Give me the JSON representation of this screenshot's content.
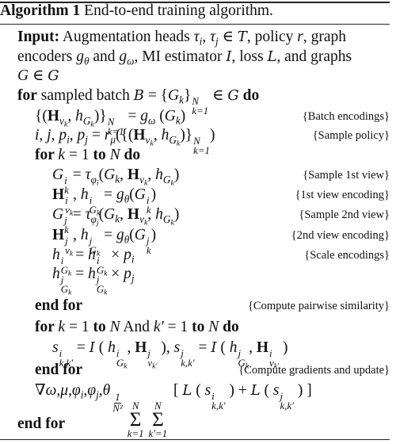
{
  "title": {
    "label": "Algorithm 1",
    "caption": " End-to-end training algorithm."
  },
  "lines": [
    {
      "indent": 1,
      "segs": [
        [
          "kw",
          "Input:"
        ],
        [
          "r",
          " Augmentation heads "
        ],
        [
          "m",
          "τ"
        ],
        [
          "sub",
          "i"
        ],
        [
          "r",
          ", "
        ],
        [
          "m",
          "τ"
        ],
        [
          "sub",
          "j"
        ],
        [
          "r",
          " ∈ "
        ],
        [
          "cal",
          "T"
        ],
        [
          "r",
          ", policy "
        ],
        [
          "m",
          "r"
        ],
        [
          "r",
          ", graph"
        ]
      ]
    },
    {
      "indent": 1,
      "segs": [
        [
          "r",
          "encoders "
        ],
        [
          "m",
          "g"
        ],
        [
          "sub",
          "θ"
        ],
        [
          "r",
          " and "
        ],
        [
          "m",
          "g"
        ],
        [
          "sub",
          "ω"
        ],
        [
          "r",
          ", MI estimator "
        ],
        [
          "cal",
          "I"
        ],
        [
          "r",
          ", loss "
        ],
        [
          "cal",
          "L"
        ],
        [
          "r",
          ", and graphs"
        ]
      ]
    },
    {
      "indent": 1,
      "segs": [
        [
          "m",
          "G"
        ],
        [
          "r",
          " ∈ "
        ],
        [
          "cal",
          "G"
        ]
      ]
    },
    {
      "indent": 1,
      "segs": [
        [
          "kw",
          "for"
        ],
        [
          "r",
          " sampled batch "
        ],
        [
          "cal",
          "B"
        ],
        [
          "r",
          " = {"
        ],
        [
          "m",
          "G"
        ],
        [
          "sub",
          "k"
        ],
        [
          "r",
          "}"
        ],
        [
          "ss",
          "N",
          "k=1"
        ],
        [
          "r",
          " ∈ "
        ],
        [
          "cal",
          "G"
        ],
        [
          "kw",
          " do"
        ]
      ]
    },
    {
      "indent": 2,
      "segs": [
        [
          "r",
          "{("
        ],
        [
          "B",
          "H"
        ],
        [
          "sub",
          "v_k"
        ],
        [
          "r",
          ", "
        ],
        [
          "m",
          "h"
        ],
        [
          "sub",
          "G_k"
        ],
        [
          "r",
          ")}"
        ],
        [
          "ss",
          "N",
          "k=1"
        ],
        [
          "r",
          " = "
        ],
        [
          "m",
          "g"
        ],
        [
          "sub",
          "ω"
        ],
        [
          "r",
          " ("
        ],
        [
          "m",
          "G"
        ],
        [
          "sub",
          "k"
        ],
        [
          "r",
          ")"
        ]
      ],
      "comment": "{Batch encodings}"
    },
    {
      "indent": 2,
      "segs": [
        [
          "m",
          "i, j, p"
        ],
        [
          "sub",
          "i"
        ],
        [
          "r",
          ", "
        ],
        [
          "m",
          "p"
        ],
        [
          "sub",
          "j"
        ],
        [
          "r",
          " = "
        ],
        [
          "m",
          "r"
        ],
        [
          "sub",
          "μ"
        ],
        [
          "r",
          "({("
        ],
        [
          "B",
          "H"
        ],
        [
          "sub",
          "v_k"
        ],
        [
          "r",
          ", "
        ],
        [
          "m",
          "h"
        ],
        [
          "sub",
          "G_k"
        ],
        [
          "r",
          ")}"
        ],
        [
          "ss",
          "N",
          "k=1"
        ],
        [
          "r",
          ")"
        ]
      ],
      "comment": "{Sample policy}"
    },
    {
      "indent": 2,
      "segs": [
        [
          "kw",
          "for "
        ],
        [
          "m",
          "k"
        ],
        [
          "r",
          " = 1 "
        ],
        [
          "kw",
          "to "
        ],
        [
          "m",
          "N"
        ],
        [
          "kw",
          " do"
        ]
      ]
    },
    {
      "indent": 3,
      "segs": [
        [
          "m",
          "G"
        ],
        [
          "ss",
          "i",
          "k"
        ],
        [
          "r",
          " = "
        ],
        [
          "m",
          "τ"
        ],
        [
          "sub",
          "φ_i"
        ],
        [
          "r",
          "("
        ],
        [
          "m",
          "G"
        ],
        [
          "sub",
          "k"
        ],
        [
          "r",
          ", "
        ],
        [
          "B",
          "H"
        ],
        [
          "sub",
          "v_k"
        ],
        [
          "r",
          ", "
        ],
        [
          "m",
          "h"
        ],
        [
          "sub",
          "G_k"
        ],
        [
          "r",
          ")"
        ]
      ],
      "comment": "{Sample 1st view}"
    },
    {
      "indent": 3,
      "segs": [
        [
          "B",
          "H"
        ],
        [
          "ss",
          "i",
          "v_k"
        ],
        [
          "r",
          ", "
        ],
        [
          "m",
          "h"
        ],
        [
          "ss",
          "i",
          "G_k"
        ],
        [
          "r",
          " = "
        ],
        [
          "m",
          "g"
        ],
        [
          "sub",
          "θ"
        ],
        [
          "r",
          "("
        ],
        [
          "m",
          "G"
        ],
        [
          "ss",
          "i",
          "k"
        ],
        [
          "r",
          ")"
        ]
      ],
      "comment": "{1st view encoding}"
    },
    {
      "indent": 3,
      "segs": [
        [
          "m",
          "G"
        ],
        [
          "ss",
          "j",
          "k"
        ],
        [
          "r",
          " = "
        ],
        [
          "m",
          "τ"
        ],
        [
          "sub",
          "φ_j"
        ],
        [
          "r",
          "("
        ],
        [
          "m",
          "G"
        ],
        [
          "sub",
          "k"
        ],
        [
          "r",
          ", "
        ],
        [
          "B",
          "H"
        ],
        [
          "sub",
          "v_k"
        ],
        [
          "r",
          ", "
        ],
        [
          "m",
          "h"
        ],
        [
          "sub",
          "G_k"
        ],
        [
          "r",
          ")"
        ]
      ],
      "comment": "{Sample 2nd view}"
    },
    {
      "indent": 3,
      "segs": [
        [
          "B",
          "H"
        ],
        [
          "ss",
          "j",
          "v_k"
        ],
        [
          "r",
          ", "
        ],
        [
          "m",
          "h"
        ],
        [
          "ss",
          "j",
          "G_k"
        ],
        [
          "r",
          " = "
        ],
        [
          "m",
          "g"
        ],
        [
          "sub",
          "θ"
        ],
        [
          "r",
          "("
        ],
        [
          "m",
          "G"
        ],
        [
          "ss",
          "j",
          "k"
        ],
        [
          "r",
          ")"
        ]
      ],
      "comment": "{2nd view encoding}"
    },
    {
      "indent": 3,
      "segs": [
        [
          "m",
          "h"
        ],
        [
          "ss",
          "i",
          "G_k"
        ],
        [
          "r",
          " = "
        ],
        [
          "m",
          "h"
        ],
        [
          "ss",
          "i",
          "G_k"
        ],
        [
          "r",
          " × "
        ],
        [
          "m",
          "p"
        ],
        [
          "sub",
          "i"
        ]
      ],
      "comment": "{Scale encodings}"
    },
    {
      "indent": 3,
      "segs": [
        [
          "m",
          "h"
        ],
        [
          "ss",
          "j",
          "G_k"
        ],
        [
          "r",
          " = "
        ],
        [
          "m",
          "h"
        ],
        [
          "ss",
          "j",
          "G_k"
        ],
        [
          "r",
          " × "
        ],
        [
          "m",
          "p"
        ],
        [
          "sub",
          "j"
        ]
      ]
    },
    {
      "indent": 2,
      "segs": [
        [
          "kw",
          "end for"
        ]
      ],
      "comment": "{Compute pairwise similarity}"
    },
    {
      "indent": 2,
      "segs": [
        [
          "kw",
          "for "
        ],
        [
          "m",
          "k"
        ],
        [
          "r",
          " = 1 "
        ],
        [
          "kw",
          "to "
        ],
        [
          "m",
          "N"
        ],
        [
          "r",
          " And "
        ],
        [
          "m",
          "k′"
        ],
        [
          "r",
          " = 1 "
        ],
        [
          "kw",
          "to "
        ],
        [
          "m",
          "N"
        ],
        [
          "kw",
          " do"
        ]
      ]
    },
    {
      "indent": 3,
      "segs": [
        [
          "m",
          "s"
        ],
        [
          "ss",
          "i",
          "k,k′"
        ],
        [
          "r",
          " = "
        ],
        [
          "cal",
          "I"
        ],
        [
          "r",
          " ( "
        ],
        [
          "m",
          "h"
        ],
        [
          "ss",
          "i",
          "G_k"
        ],
        [
          "r",
          ", "
        ],
        [
          "B",
          "H"
        ],
        [
          "ss",
          "j",
          "v_k′"
        ],
        [
          "r",
          " ), "
        ],
        [
          "m",
          "s"
        ],
        [
          "ss",
          "j",
          "k,k′"
        ],
        [
          "r",
          " = "
        ],
        [
          "cal",
          "I"
        ],
        [
          "r",
          " ( "
        ],
        [
          "m",
          "h"
        ],
        [
          "ss",
          "j",
          "G_k"
        ],
        [
          "r",
          ", "
        ],
        [
          "B",
          "H"
        ],
        [
          "ss",
          "i",
          "v_k′"
        ],
        [
          "r",
          " )"
        ]
      ]
    },
    {
      "indent": 2,
      "segs": [
        [
          "kw",
          "end for"
        ]
      ],
      "comment": "{Compute gradients and update}"
    },
    {
      "indent": 2,
      "segs": [
        [
          "r",
          "∇"
        ],
        [
          "m",
          "ω,μ,φ"
        ],
        [
          "sub",
          "i"
        ],
        [
          "m",
          ",φ"
        ],
        [
          "sub",
          "j"
        ],
        [
          "m",
          ",θ"
        ],
        [
          "frac",
          "1",
          "N²"
        ],
        [
          "sum",
          "N",
          "k=1"
        ],
        [
          "sum",
          "N",
          "k′=1"
        ],
        [
          "r",
          " [ "
        ],
        [
          "cal",
          "L"
        ],
        [
          "r",
          " ( "
        ],
        [
          "m",
          "s"
        ],
        [
          "ss",
          "i",
          "k,k′"
        ],
        [
          "r",
          " ) + "
        ],
        [
          "cal",
          "L"
        ],
        [
          "r",
          " ( "
        ],
        [
          "m",
          "s"
        ],
        [
          "ss",
          "j",
          "k,k′"
        ],
        [
          "r",
          " ) ]"
        ]
      ]
    },
    {
      "indent": 1,
      "segs": [
        [
          "kw",
          "end for"
        ]
      ]
    }
  ]
}
